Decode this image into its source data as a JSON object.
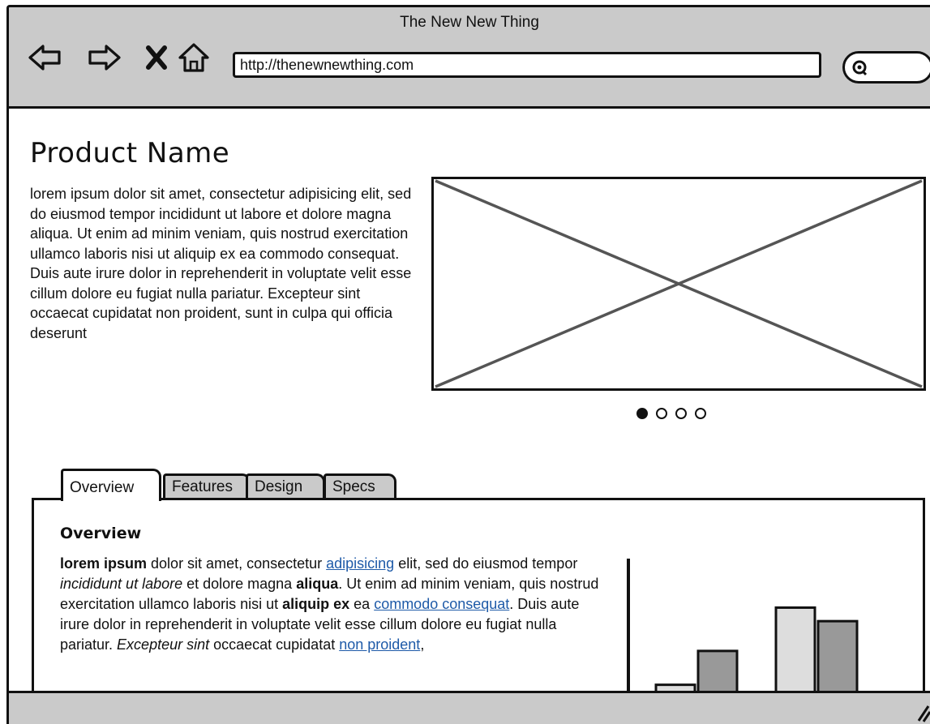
{
  "window": {
    "title": "The New New Thing"
  },
  "toolbar": {
    "back_icon": "back-arrow-icon",
    "forward_icon": "forward-arrow-icon",
    "stop_icon": "stop-x-icon",
    "home_icon": "home-icon",
    "url": "http://thenewnewthing.com",
    "search_icon": "search-icon"
  },
  "product": {
    "name": "Product Name",
    "description": "lorem ipsum dolor sit amet, consectetur adipisicing elit, sed do eiusmod tempor incididunt ut labore et dolore magna aliqua. Ut enim ad minim veniam, quis nostrud exercitation ullamco laboris nisi ut aliquip ex ea commodo consequat. Duis aute irure dolor in reprehenderit in voluptate velit esse cillum dolore eu fugiat nulla pariatur. Excepteur sint occaecat cupidatat non proident, sunt in culpa qui officia deserunt"
  },
  "carousel": {
    "total": 4,
    "active_index": 0
  },
  "tabs": [
    {
      "label": "Overview",
      "active": true
    },
    {
      "label": "Features",
      "active": false
    },
    {
      "label": "Design",
      "active": false
    },
    {
      "label": "Specs",
      "active": false
    }
  ],
  "overview": {
    "heading": "Overview",
    "segments": [
      {
        "text": "lorem ipsum",
        "style": "bold"
      },
      {
        "text": " dolor sit amet, consectetur ",
        "style": "normal"
      },
      {
        "text": "adipisicing",
        "style": "link"
      },
      {
        "text": " elit, sed do eiusmod tempor ",
        "style": "normal"
      },
      {
        "text": "incididunt ut labore",
        "style": "italic"
      },
      {
        "text": " et dolore magna ",
        "style": "normal"
      },
      {
        "text": "aliqua",
        "style": "bold"
      },
      {
        "text": ". Ut enim ad minim veniam, quis nostrud exercitation ullamco laboris nisi ut ",
        "style": "normal"
      },
      {
        "text": "aliquip ex",
        "style": "bold"
      },
      {
        "text": " ea ",
        "style": "normal"
      },
      {
        "text": "commodo consequat",
        "style": "link"
      },
      {
        "text": ". Duis aute irure dolor in reprehenderit in voluptate velit esse cillum dolore eu fugiat nulla pariatur. ",
        "style": "normal"
      },
      {
        "text": "Excepteur sint",
        "style": "italic"
      },
      {
        "text": " occaecat cupidatat ",
        "style": "normal"
      },
      {
        "text": "non proident",
        "style": "link"
      },
      {
        "text": ",",
        "style": "normal"
      }
    ]
  },
  "chart_data": {
    "type": "bar",
    "ylim": [
      0,
      10
    ],
    "grid": false,
    "series": [
      {
        "values": [
          0.8,
          6.5
        ],
        "color": "#dddddd"
      },
      {
        "values": [
          3.3,
          5.5
        ],
        "color": "#999999"
      }
    ]
  },
  "colors": {
    "chrome": "#cacaca",
    "link": "#1e5aa8",
    "bar_light": "#dddddd",
    "bar_dark": "#999999"
  }
}
